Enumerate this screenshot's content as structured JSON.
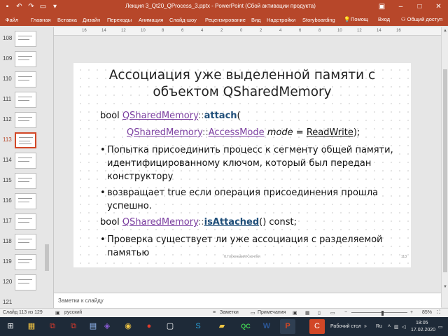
{
  "window": {
    "title": "Лекция 3_Qt20_QProcess_3.pptx - PowerPoint (Сбой активации продукта)",
    "qat_icons": [
      "save-icon",
      "undo-icon",
      "redo-icon",
      "slideshow-icon",
      "customize-icon"
    ]
  },
  "ribbon": {
    "file": "Файл",
    "tabs": [
      "Главная",
      "Вставка",
      "Дизайн",
      "Переходы",
      "Анимация",
      "Слайд-шоу",
      "Рецензирование",
      "Вид",
      "Надстройки",
      "Storyboarding"
    ],
    "help": "Помощ",
    "signin": "Вход",
    "share": "Общий доступ"
  },
  "ruler": {
    "ticks": [
      "16",
      "14",
      "12",
      "10",
      "8",
      "6",
      "4",
      "2",
      "0",
      "2",
      "4",
      "6",
      "8",
      "10",
      "12",
      "14",
      "16"
    ]
  },
  "thumbnails": [
    {
      "num": "108",
      "active": false
    },
    {
      "num": "109",
      "active": false
    },
    {
      "num": "110",
      "active": false
    },
    {
      "num": "111",
      "active": false
    },
    {
      "num": "112",
      "active": false
    },
    {
      "num": "113",
      "active": true
    },
    {
      "num": "114",
      "active": false
    },
    {
      "num": "115",
      "active": false
    },
    {
      "num": "116",
      "active": false
    },
    {
      "num": "117",
      "active": false
    },
    {
      "num": "118",
      "active": false
    },
    {
      "num": "119",
      "active": false
    },
    {
      "num": "120",
      "active": false
    },
    {
      "num": "121",
      "active": false
    }
  ],
  "slide": {
    "title_line1": "Ассоциация уже выделенной памяти с",
    "title_line2": "объектом QSharedMemory",
    "sig1": {
      "type": "bool ",
      "cls": "QSharedMemory",
      "scope": "::",
      "fn": "attach",
      "open": "("
    },
    "sig1b": {
      "cls": "QSharedMemory",
      "scope": "::",
      "enum": "AccessMode",
      "param": "mode",
      "eq": " = ",
      "default": "ReadWrite",
      "close": ");"
    },
    "bullet1": "Попытка присоединить процесс к сегменту общей памяти, идентифицированному ключом, который был передан конструктору",
    "bullet2": "возвращает true если операция присоединения прошла успешно.",
    "sig2": {
      "type": "bool ",
      "cls": "QSharedMemory",
      "scope": "::",
      "fn": "isAttached",
      "rest": "() const;"
    },
    "bullet3": "Проверка существует ли уже ассоциация с разделяемой памятью",
    "footer": "К.Глухенький К.кочтия",
    "number": "113"
  },
  "notes": {
    "label": "Заметки к слайду"
  },
  "statusbar": {
    "slide": "Слайд 113 из 129",
    "lang": "русский",
    "notes": "Заметки",
    "comments": "Примечания",
    "zoom": "85%"
  },
  "taskbar": {
    "desktop": "Рабочий стол",
    "lang": "Ru",
    "time": "18:05",
    "date": "17.02.2020",
    "apps": [
      "windows-icon",
      "file-manager-icon",
      "pdf-icon",
      "pdf-icon",
      "files-icon",
      "chrome-icon",
      "yandex-icon",
      "skype-icon",
      "folder-icon",
      "qt-icon",
      "word-icon",
      "powerpoint-icon",
      "record-icon"
    ]
  },
  "colors": {
    "accent": "#b7472a",
    "class_link": "#7b3fa0",
    "function": "#1f4e79",
    "active_thumb": "#d24726",
    "taskbar": "#1e2a38"
  }
}
